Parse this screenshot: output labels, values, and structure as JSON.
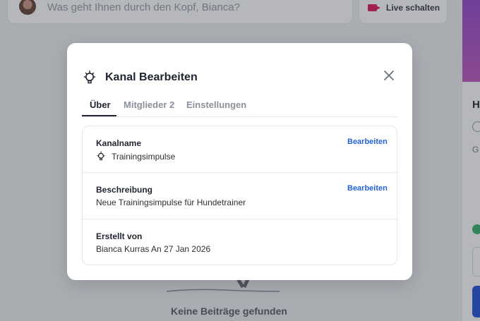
{
  "background": {
    "composer_placeholder": "Was geht Ihnen durch den Kopf, Bianca?",
    "live_button_label": "Live schalten",
    "right_heading_initial": "H",
    "right_text_initial": "G",
    "empty_message": "Keine Beiträge gefunden"
  },
  "modal": {
    "title": "Kanal Bearbeiten",
    "tabs": [
      {
        "label": "Über",
        "active": true
      },
      {
        "label": "Mitglieder 2",
        "active": false
      },
      {
        "label": "Einstellungen",
        "active": false
      }
    ],
    "rows": [
      {
        "label": "Kanalname",
        "value": "Trainingsimpulse",
        "action": "Bearbeiten"
      },
      {
        "label": "Beschreibung",
        "value": "Neue Trainingsimpulse für Hundetrainer",
        "action": "Bearbeiten"
      },
      {
        "label": "Erstellt von",
        "value": "Bianca Kurras An 27 Jan 2026"
      }
    ]
  },
  "colors": {
    "accent_link": "#2462d6",
    "live_icon": "#e0245e",
    "overlay": "rgba(25,30,40,0.32)"
  }
}
